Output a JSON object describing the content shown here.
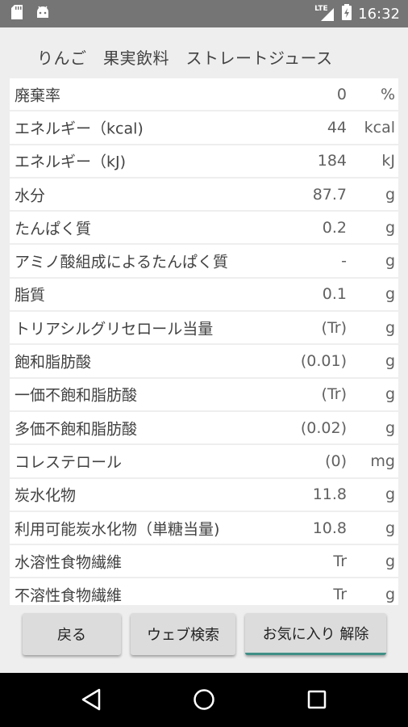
{
  "status_bar": {
    "network": "LTE",
    "time": "16:32"
  },
  "header": {
    "title": "りんご　果実飲料　ストレートジュース"
  },
  "nutrients": [
    {
      "name": "廃棄率",
      "value": "0",
      "unit": "%"
    },
    {
      "name": "エネルギー（kcal)",
      "value": "44",
      "unit": "kcal"
    },
    {
      "name": "エネルギー（kJ)",
      "value": "184",
      "unit": "kJ"
    },
    {
      "name": "水分",
      "value": "87.7",
      "unit": "g"
    },
    {
      "name": "たんぱく質",
      "value": "0.2",
      "unit": "g"
    },
    {
      "name": "アミノ酸組成によるたんぱく質",
      "value": "-",
      "unit": "g"
    },
    {
      "name": "脂質",
      "value": "0.1",
      "unit": "g"
    },
    {
      "name": "トリアシルグリセロール当量",
      "value": "(Tr)",
      "unit": "g"
    },
    {
      "name": "飽和脂肪酸",
      "value": "(0.01)",
      "unit": "g"
    },
    {
      "name": "一価不飽和脂肪酸",
      "value": "(Tr)",
      "unit": "g"
    },
    {
      "name": "多価不飽和脂肪酸",
      "value": "(0.02)",
      "unit": "g"
    },
    {
      "name": "コレステロール",
      "value": "(0)",
      "unit": "mg"
    },
    {
      "name": "炭水化物",
      "value": "11.8",
      "unit": "g"
    },
    {
      "name": "利用可能炭水化物（単糖当量)",
      "value": "10.8",
      "unit": "g"
    },
    {
      "name": "水溶性食物繊維",
      "value": "Tr",
      "unit": "g"
    },
    {
      "name": "不溶性食物繊維",
      "value": "Tr",
      "unit": "g"
    }
  ],
  "buttons": {
    "back": "戻る",
    "web_search": "ウェブ検索",
    "unfavorite": "お気に入り 解除"
  },
  "colors": {
    "status_bar": "#757575",
    "background": "#eeeeee",
    "row_background": "#ffffff",
    "button": "#dcdcdc",
    "accent": "#3f8f86",
    "nav_bar": "#000000"
  },
  "icons": [
    "sd-card-icon",
    "android-icon",
    "signal-icon",
    "battery-charging-icon",
    "back-nav-icon",
    "home-nav-icon",
    "recents-nav-icon"
  ]
}
